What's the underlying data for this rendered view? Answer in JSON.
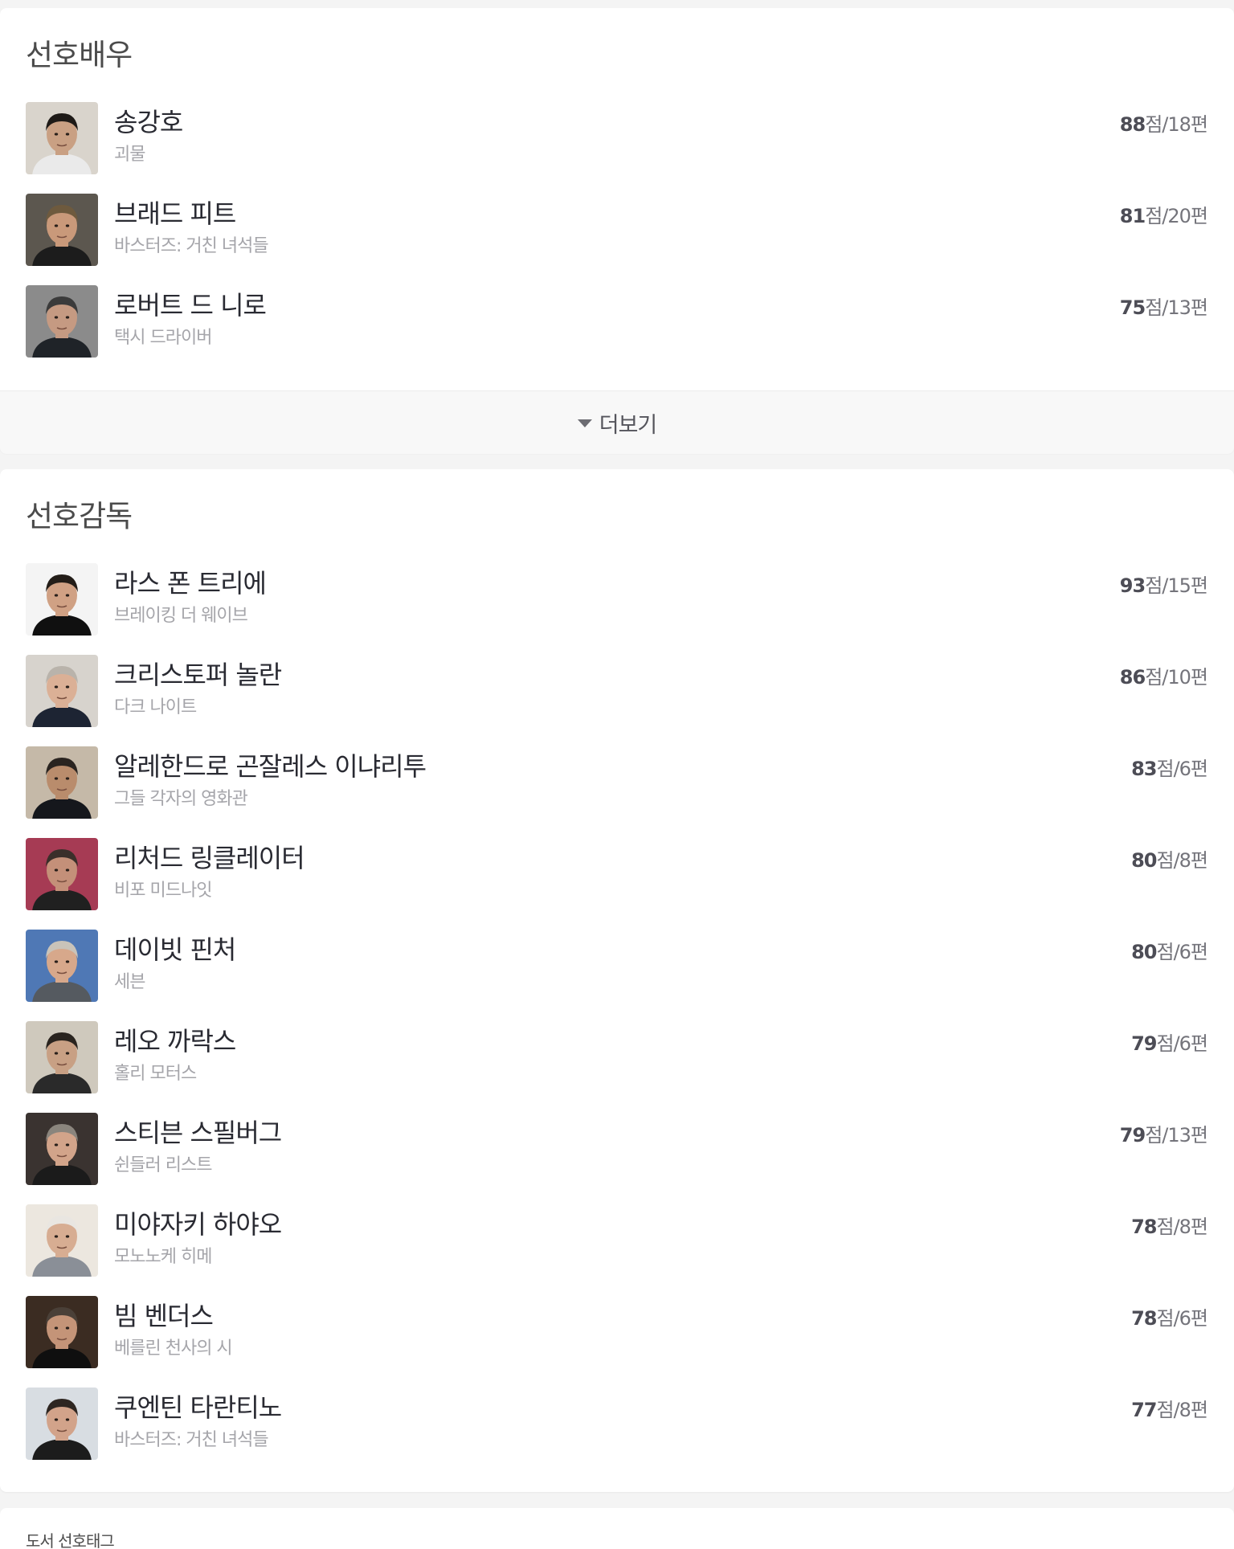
{
  "actors": {
    "title": "선호배우",
    "items": [
      {
        "name": "송강호",
        "work": "괴물",
        "score": "88",
        "score_unit": "점",
        "count": "/18편"
      },
      {
        "name": "브래드 피트",
        "work": "바스터즈: 거친 녀석들",
        "score": "81",
        "score_unit": "점",
        "count": "/20편"
      },
      {
        "name": "로버트 드 니로",
        "work": "택시 드라이버",
        "score": "75",
        "score_unit": "점",
        "count": "/13편"
      }
    ],
    "more_label": "더보기"
  },
  "directors": {
    "title": "선호감독",
    "items": [
      {
        "name": "라스 폰 트리에",
        "work": "브레이킹 더 웨이브",
        "score": "93",
        "score_unit": "점",
        "count": "/15편"
      },
      {
        "name": "크리스토퍼 놀란",
        "work": "다크 나이트",
        "score": "86",
        "score_unit": "점",
        "count": "/10편"
      },
      {
        "name": "알레한드로 곤잘레스 이냐리투",
        "work": "그들 각자의 영화관",
        "score": "83",
        "score_unit": "점",
        "count": "/6편"
      },
      {
        "name": "리처드 링클레이터",
        "work": "비포 미드나잇",
        "score": "80",
        "score_unit": "점",
        "count": "/8편"
      },
      {
        "name": "데이빗 핀처",
        "work": "세븐",
        "score": "80",
        "score_unit": "점",
        "count": "/6편"
      },
      {
        "name": "레오 까락스",
        "work": "홀리 모터스",
        "score": "79",
        "score_unit": "점",
        "count": "/6편"
      },
      {
        "name": "스티븐 스필버그",
        "work": "쉰들러 리스트",
        "score": "79",
        "score_unit": "점",
        "count": "/13편"
      },
      {
        "name": "미야자키 하야오",
        "work": "모노노케 히메",
        "score": "78",
        "score_unit": "점",
        "count": "/8편"
      },
      {
        "name": "빔 벤더스",
        "work": "베를린 천사의 시",
        "score": "78",
        "score_unit": "점",
        "count": "/6편"
      },
      {
        "name": "쿠엔틴 타란티노",
        "work": "바스터즈: 거친 녀석들",
        "score": "77",
        "score_unit": "점",
        "count": "/8편"
      }
    ]
  },
  "books": {
    "title": "도서 선호태그"
  },
  "colors": {
    "page_bg": "#f4f4f4",
    "card_bg": "#ffffff",
    "name_text": "#292a32",
    "sub_text": "#a5a5aa",
    "score_text": "#4d4d56"
  },
  "avatars": [
    {
      "icon": "person-portrait-icon",
      "bg": "#d9d4cc",
      "skin": "#c9a083",
      "hair": "#1e1a17",
      "cloth": "#eaeaea"
    },
    {
      "icon": "person-portrait-icon",
      "bg": "#5c574f",
      "skin": "#c9997a",
      "hair": "#6e5a3e",
      "cloth": "#1c1c1c"
    },
    {
      "icon": "person-portrait-icon",
      "bg": "#8b8b8b",
      "skin": "#c59a82",
      "hair": "#3b3b3b",
      "cloth": "#1f2328"
    },
    {
      "icon": "person-portrait-icon",
      "bg": "#f4f4f4",
      "skin": "#d0a184",
      "hair": "#231d18",
      "cloth": "#101010"
    },
    {
      "icon": "person-portrait-icon",
      "bg": "#d7d3cd",
      "skin": "#dbb096",
      "hair": "#b9b3ab",
      "cloth": "#1d2433"
    },
    {
      "icon": "person-portrait-icon",
      "bg": "#c5b9a8",
      "skin": "#b98c6c",
      "hair": "#2a2420",
      "cloth": "#15171c"
    },
    {
      "icon": "person-portrait-icon",
      "bg": "#a63b54",
      "skin": "#c49079",
      "hair": "#3a2f2a",
      "cloth": "#202020"
    },
    {
      "icon": "person-portrait-icon",
      "bg": "#4f78b5",
      "skin": "#d7a88b",
      "hair": "#c9c3b9",
      "cloth": "#555a60"
    },
    {
      "icon": "person-portrait-icon",
      "bg": "#cfc9bd",
      "skin": "#c8a084",
      "hair": "#2a241f",
      "cloth": "#2a2a2a"
    },
    {
      "icon": "person-portrait-icon",
      "bg": "#3a3330",
      "skin": "#d2a48a",
      "hair": "#8a857d",
      "cloth": "#1b1b1b"
    },
    {
      "icon": "person-portrait-icon",
      "bg": "#ece7df",
      "skin": "#d7ad92",
      "hair": "#e9e6e1",
      "cloth": "#8a8f97"
    },
    {
      "icon": "person-portrait-icon",
      "bg": "#3b2c22",
      "skin": "#c49478",
      "hair": "#4a4038",
      "cloth": "#0f0f0f"
    },
    {
      "icon": "person-portrait-icon",
      "bg": "#d8dde2",
      "skin": "#d2a38a",
      "hair": "#2e2621",
      "cloth": "#1c1c1c"
    }
  ]
}
